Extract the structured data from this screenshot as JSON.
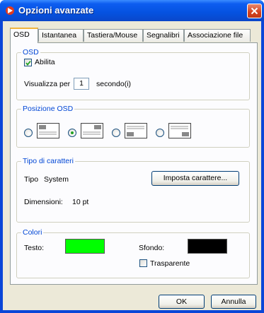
{
  "window": {
    "title": "Opzioni avanzate"
  },
  "tabs": [
    {
      "label": "OSD",
      "active": true
    },
    {
      "label": "Istantanea"
    },
    {
      "label": "Tastiera/Mouse"
    },
    {
      "label": "Segnalibri"
    },
    {
      "label": "Associazione file"
    }
  ],
  "osd": {
    "group_label": "OSD",
    "enable_label": "Abilita",
    "enable_checked": true,
    "display_for_label": "Visualizza per",
    "display_value": "1",
    "display_unit": "secondo(i)"
  },
  "position": {
    "group_label": "Posizione OSD",
    "options": [
      {
        "name": "top-left",
        "selected": false
      },
      {
        "name": "top-right",
        "selected": true
      },
      {
        "name": "bottom-left",
        "selected": false
      },
      {
        "name": "bottom-right",
        "selected": false
      }
    ]
  },
  "font": {
    "group_label": "Tipo di caratteri",
    "type_label": "Tipo",
    "type_value": "System",
    "set_button": "Imposta carattere...",
    "size_label": "Dimensioni:",
    "size_value": "10 pt"
  },
  "colors": {
    "group_label": "Colori",
    "text_label": "Testo:",
    "text_color": "#00ff00",
    "bg_label": "Sfondo:",
    "bg_color": "#000000",
    "transparent_label": "Trasparente",
    "transparent_checked": false
  },
  "buttons": {
    "ok": "OK",
    "cancel": "Annulla"
  }
}
